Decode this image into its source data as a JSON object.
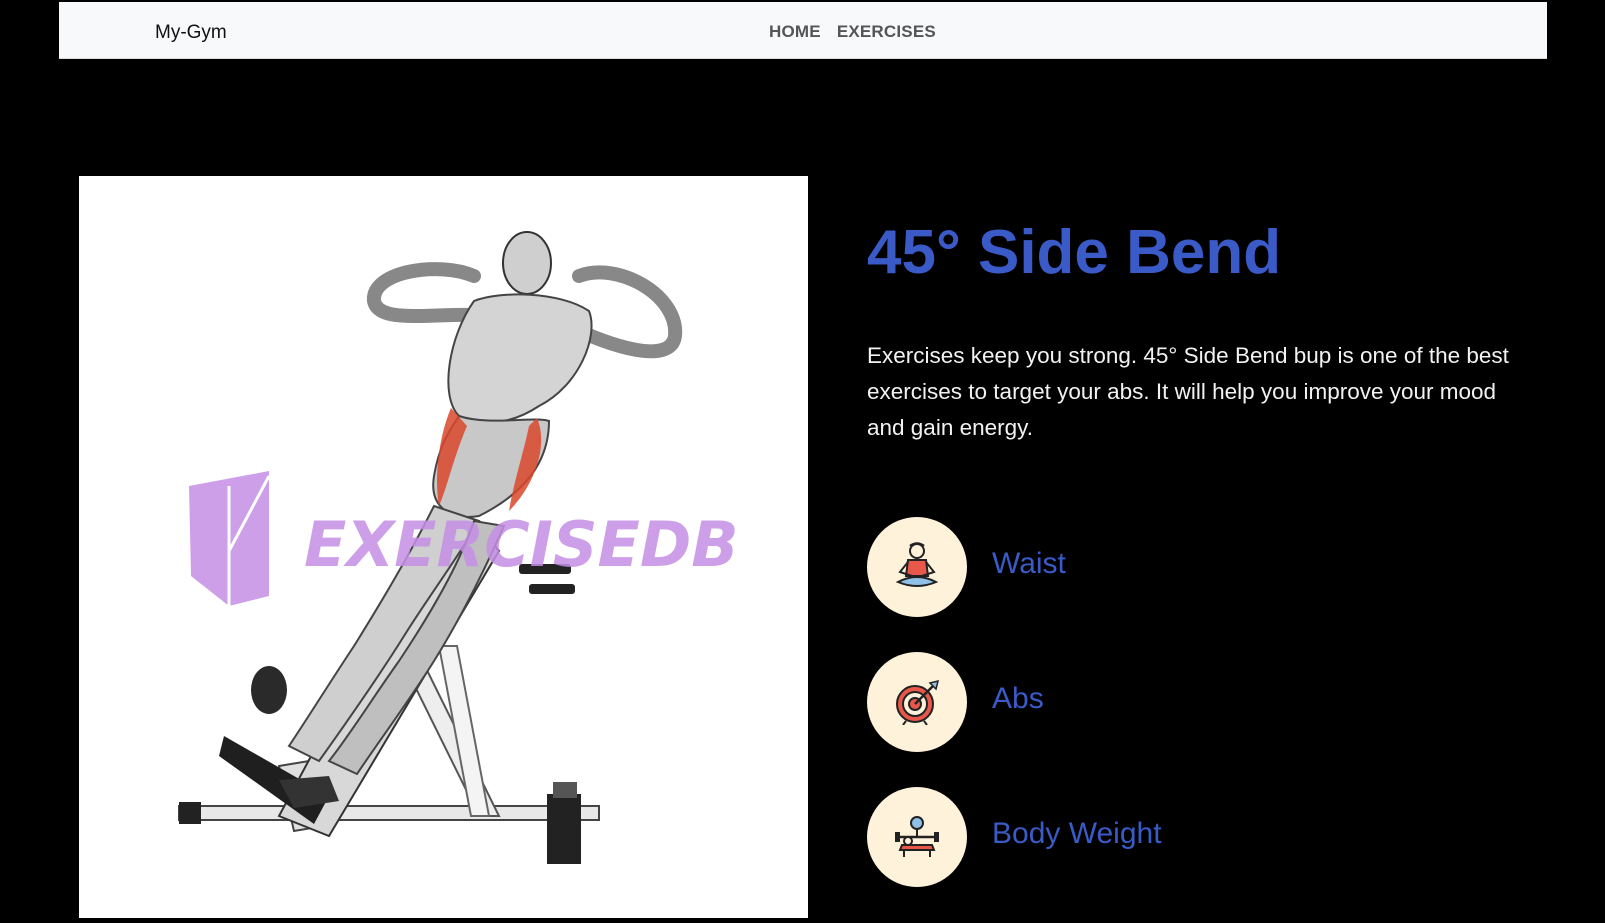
{
  "navbar": {
    "brand": "My-Gym",
    "links": [
      "HOME",
      "EXERCISES"
    ]
  },
  "exercise": {
    "title": "45° Side Bend",
    "description_lines": [
      "Exercises keep you strong. 45° Side Bend bup is one of the best",
      "exercises to target your abs. It will help you improve your mood and gain energy."
    ],
    "image_watermark": "EXERCISEDB",
    "tags": [
      {
        "label": "Waist",
        "icon": "meditation-person-icon"
      },
      {
        "label": "Abs",
        "icon": "target-arrow-icon"
      },
      {
        "label": "Body Weight",
        "icon": "bench-press-icon"
      }
    ]
  },
  "colors": {
    "accent": "#3a5bc7",
    "page_background": "#000000",
    "navbar_background": "#f8f9fa",
    "tag_circle": "#fff2db",
    "muscle_highlight": "#d9462b",
    "watermark": "#c58fe6"
  }
}
